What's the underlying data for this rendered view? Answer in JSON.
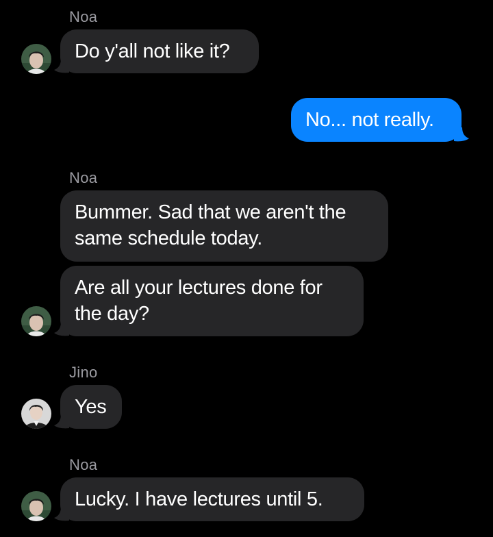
{
  "messages": [
    {
      "sender": "Noa",
      "text": "Do y'all not like it?",
      "direction": "incoming"
    },
    {
      "sender": "",
      "text": "No... not really.",
      "direction": "outgoing"
    },
    {
      "sender": "Noa",
      "text": "Bummer. Sad that we aren't the same schedule today.",
      "direction": "incoming"
    },
    {
      "sender": "",
      "text": "Are all your lectures done for the day?",
      "direction": "incoming"
    },
    {
      "sender": "Jino",
      "text": "Yes",
      "direction": "incoming"
    },
    {
      "sender": "Noa",
      "text": "Lucky. I have lectures until 5.",
      "direction": "incoming"
    }
  ],
  "colors": {
    "background": "#000000",
    "incoming_bubble": "#262628",
    "outgoing_bubble": "#0a84ff",
    "sender_name": "#9a9aa0"
  },
  "icons": {
    "avatar_noa": "avatar-noa-icon",
    "avatar_jino": "avatar-jino-icon"
  }
}
